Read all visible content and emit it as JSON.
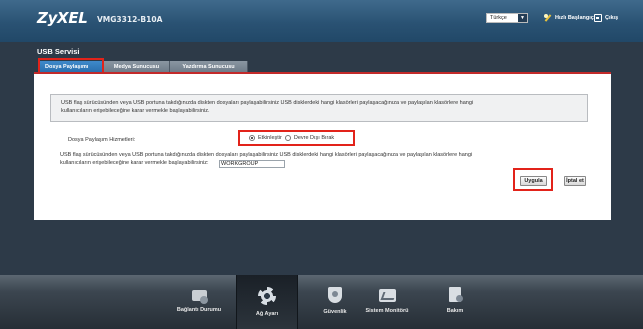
{
  "header": {
    "logo": "ZyXEL",
    "model": "VMG3312-B10A",
    "language": "Türkçe",
    "wizard_label": "Hızlı Başlangıç",
    "logout_label": "Çıkış"
  },
  "page": {
    "title": "USB Servisi"
  },
  "tabs": [
    {
      "label": "Dosya Paylaşımı",
      "active": true
    },
    {
      "label": "Medya Sunucusu",
      "active": false
    },
    {
      "label": "Yazdırma Sunucusu",
      "active": false
    }
  ],
  "info": {
    "line1": "USB flaş sürücüsünden veya USB portuna takdığınızda diskten dosyaları paylaşabilirsiniz USB disklerdeki hangi klasörleri paylaşacağınıza ve paylaşılan klasörlere hangi",
    "line2": "kullanıcıların erişebileceğine karar vermekle başlayabilirsiniz."
  },
  "service": {
    "label": "Dosya Paylaşım Hizmetleri:",
    "enable_label": "Etkinleştir",
    "disable_label": "Devre Dışı Bırak",
    "selected": "enable"
  },
  "description": {
    "line1": "USB flaş sürücüsünden veya USB portuna takdığınızda diskten dosyaları paylaşabilirsiniz USB disklerdeki hangi klasörleri paylaşacağınıza ve paylaşılan klasörlere hangi",
    "line2": "kullanıcıların erişebileceğine karar vermekle başlayabilirsiniz:"
  },
  "workgroup": {
    "value": "WORKGROUP"
  },
  "buttons": {
    "apply": "Uygula",
    "cancel": "İptal et"
  },
  "bottom_nav": [
    {
      "label": "Bağlantı Durumu",
      "icon": "status-icon",
      "active": false
    },
    {
      "label": "Ağ Ayarı",
      "icon": "network-settings-icon",
      "active": true
    },
    {
      "label": "Güvenlik",
      "icon": "security-icon",
      "active": false
    },
    {
      "label": "Sistem Monitörü",
      "icon": "monitor-icon",
      "active": false
    },
    {
      "label": "Bakım",
      "icon": "maintenance-icon",
      "active": false
    }
  ],
  "colors": {
    "header_blue": "#2a5273",
    "tab_active": "#3f8acb",
    "highlight_red": "#e2231a",
    "panel_top_border": "#c22a2a"
  }
}
